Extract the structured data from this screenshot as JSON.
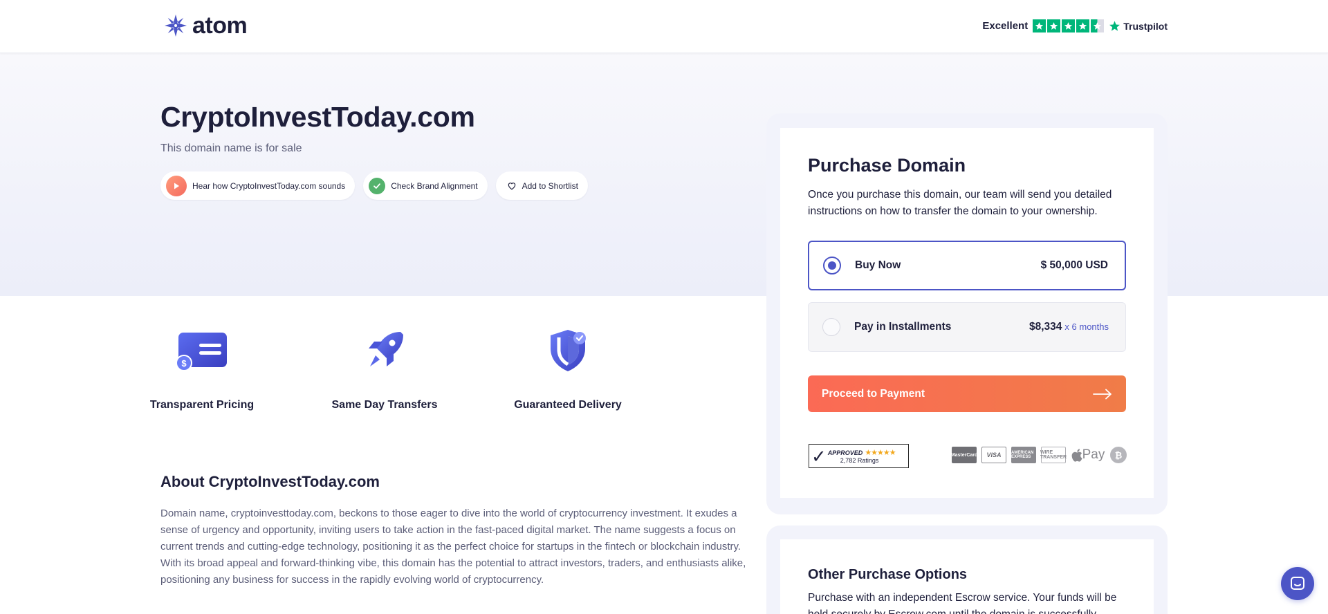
{
  "header": {
    "logo_text": "atom",
    "trustpilot": {
      "rating_word": "Excellent",
      "stars": 4.5,
      "brand": "Trustpilot"
    }
  },
  "hero": {
    "domain": "CryptoInvestToday.com",
    "subtitle": "This domain name is for sale",
    "chips": {
      "hear": "Hear how CryptoInvestToday.com sounds",
      "brand": "Check Brand Alignment",
      "shortlist": "Add to Shortlist"
    }
  },
  "features": [
    {
      "label": "Transparent Pricing",
      "icon": "card-dollar-icon"
    },
    {
      "label": "Same Day Transfers",
      "icon": "rocket-icon"
    },
    {
      "label": "Guaranteed Delivery",
      "icon": "shield-check-icon"
    }
  ],
  "about": {
    "title": "About CryptoInvestToday.com",
    "text": "Domain name, cryptoinvesttoday.com, beckons to those eager to dive into the world of cryptocurrency investment. It exudes a sense of urgency and opportunity, inviting users to take action in the fast-paced digital market. The name suggests a focus on current trends and cutting-edge technology, positioning it as the perfect choice for startups in the fintech or blockchain industry. With its broad appeal and forward-thinking vibe, this domain has the potential to attract investors, traders, and enthusiasts alike, positioning any business for success in the rapidly evolving world of cryptocurrency."
  },
  "purchase": {
    "title": "Purchase Domain",
    "description": "Once you purchase this domain, our team will send you detailed instructions on how to transfer the domain to your ownership.",
    "options": {
      "buy_now": {
        "label": "Buy Now",
        "price": "$ 50,000 USD",
        "selected": true
      },
      "installments": {
        "label": "Pay in Installments",
        "price": "$8,334",
        "suffix": "x 6 months",
        "selected": false
      }
    },
    "proceed_label": "Proceed to Payment",
    "approved": {
      "word": "APPROVED",
      "ratings": "2,782 Ratings"
    },
    "payment_methods": {
      "mastercard": "MasterCard",
      "visa": "VISA",
      "amex": "AMERICAN EXPRESS",
      "wire": "WIRE TRANSFER",
      "apple": "Pay",
      "bitcoin": "₿"
    }
  },
  "other": {
    "title": "Other Purchase Options",
    "text": "Purchase with an independent Escrow service. Your funds will be held securely by Escrow.com until the domain is successfully"
  },
  "colors": {
    "accent": "#4c55c6",
    "cta": "#fb6a55",
    "trustpilot": "#00b67a",
    "text": "#1e1f3b"
  }
}
